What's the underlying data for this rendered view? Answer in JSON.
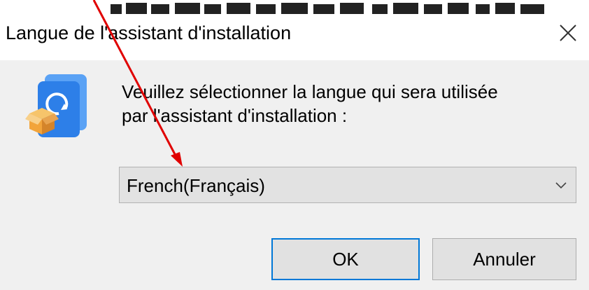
{
  "window": {
    "title": "Langue de l'assistant d'installation"
  },
  "dialog": {
    "message_line1": "Veuillez sélectionner la langue qui sera utilisée",
    "message_line2": "par l'assistant d'installation :",
    "language_select": {
      "selected": "French(Français)"
    },
    "buttons": {
      "ok": "OK",
      "cancel": "Annuler"
    }
  },
  "icons": {
    "app": "installer-box-icon",
    "close": "close-icon",
    "chevron": "chevron-down-icon"
  },
  "colors": {
    "dialog_bg": "#f0f0f0",
    "titlebar_bg": "#ffffff",
    "focus_border": "#0078d7",
    "annotation_arrow": "#e00000",
    "app_icon_blue": "#2d7fe8",
    "app_icon_box": "#f2a43a"
  }
}
